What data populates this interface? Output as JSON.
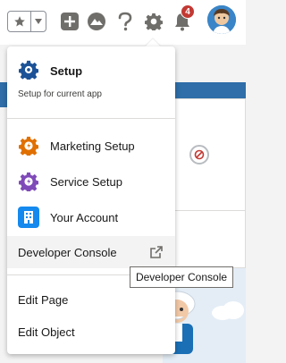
{
  "header": {
    "notification_count": "4"
  },
  "menu": {
    "setup": {
      "title": "Setup",
      "subtitle": "Setup for current app",
      "color": "#1b5297"
    },
    "items": [
      {
        "label": "Marketing Setup",
        "icon": "gear-icon",
        "color": "#e07000"
      },
      {
        "label": "Service Setup",
        "icon": "gear-icon",
        "color": "#7f4ab8"
      },
      {
        "label": "Your Account",
        "icon": "building-icon",
        "color": "#1589ee"
      }
    ],
    "developer_console": "Developer Console",
    "edit_page": "Edit Page",
    "edit_object": "Edit Object"
  },
  "tooltip": {
    "text": "Developer Console"
  }
}
